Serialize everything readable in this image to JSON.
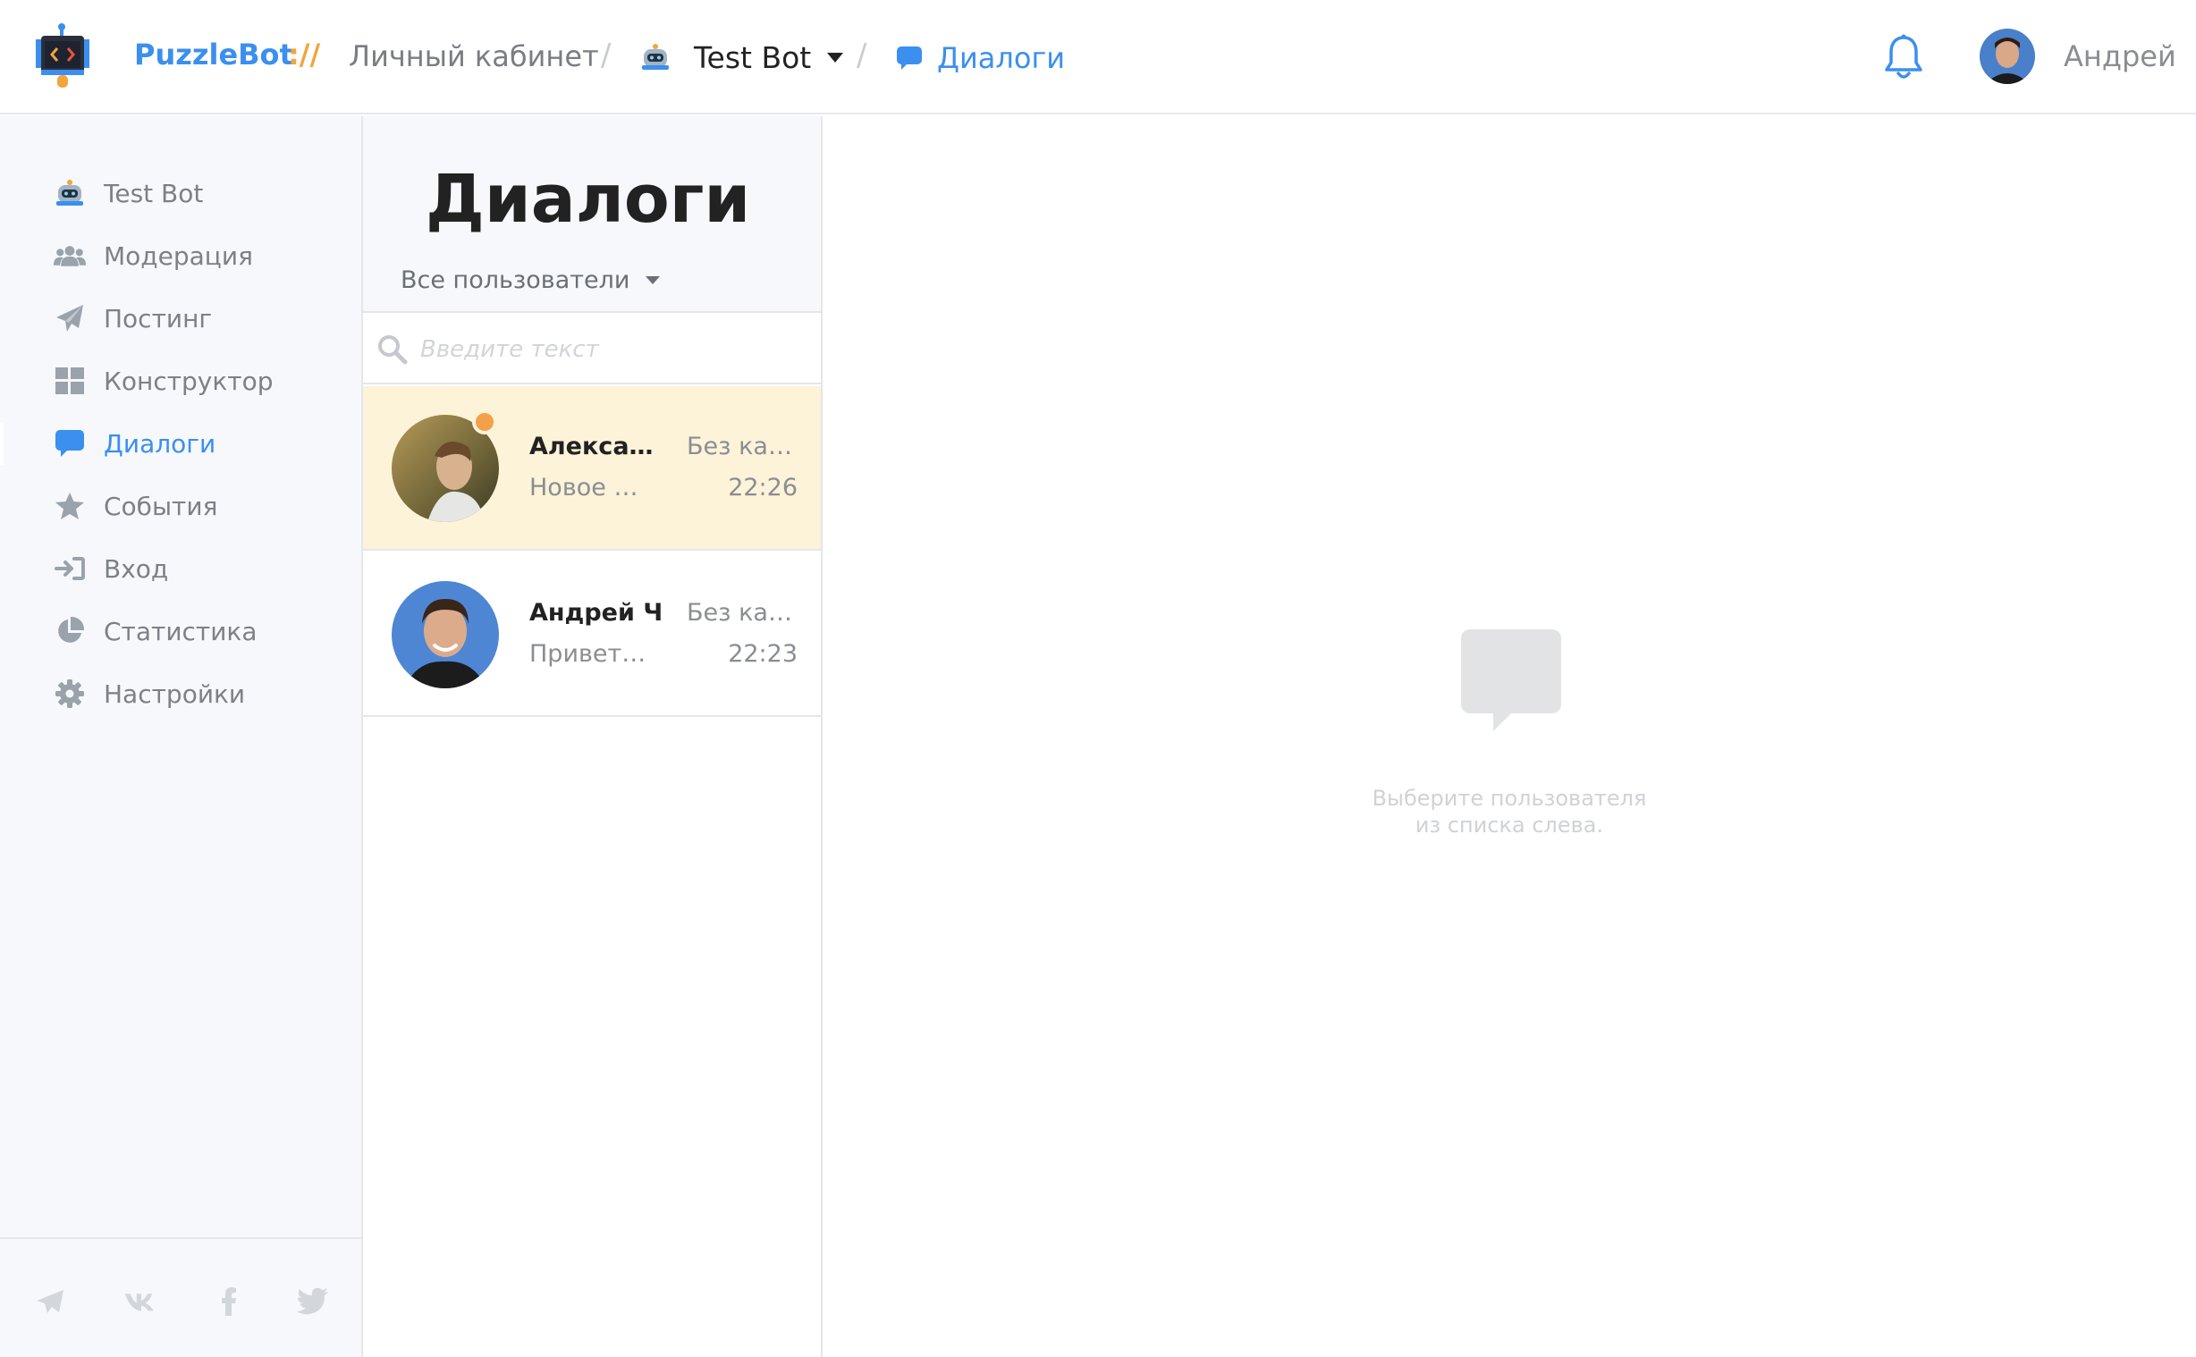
{
  "header": {
    "brand": "PuzzleBot",
    "brand_separator": "://",
    "cabinet": "Личный кабинет",
    "bot_name": "Test Bot",
    "current_section": "Диалоги",
    "user_name": "Андрей"
  },
  "sidebar": {
    "items": [
      {
        "label": "Test Bot",
        "icon": "robot-icon",
        "active": false
      },
      {
        "label": "Модерация",
        "icon": "users-icon",
        "active": false
      },
      {
        "label": "Постинг",
        "icon": "paper-plane-icon",
        "active": false
      },
      {
        "label": "Конструктор",
        "icon": "grid-icon",
        "active": false
      },
      {
        "label": "Диалоги",
        "icon": "chat-bubble-icon",
        "active": true
      },
      {
        "label": "События",
        "icon": "star-icon",
        "active": false
      },
      {
        "label": "Вход",
        "icon": "sign-in-icon",
        "active": false
      },
      {
        "label": "Статистика",
        "icon": "pie-chart-icon",
        "active": false
      },
      {
        "label": "Настройки",
        "icon": "gear-icon",
        "active": false
      }
    ],
    "social": [
      "telegram-icon",
      "vk-icon",
      "facebook-icon",
      "twitter-icon"
    ]
  },
  "dialogs": {
    "title": "Диалоги",
    "filter": "Все пользователи",
    "search_placeholder": "Введите текст",
    "items": [
      {
        "name": "Александр",
        "category": "Без категории",
        "preview": "Новое сообщение",
        "time": "22:26",
        "unread": true,
        "active": true
      },
      {
        "name": "Андрей Ч",
        "category": "Без категории",
        "preview": "Привет, как дела",
        "time": "22:23",
        "unread": false,
        "active": false
      }
    ]
  },
  "main": {
    "empty_text": "Выберите пользователя\nиз списка слева."
  },
  "colors": {
    "accent": "#3b8fef",
    "brand_orange": "#f2a53d",
    "active_row": "#fdf3d9",
    "sidebar_bg": "#f6f8fc"
  }
}
